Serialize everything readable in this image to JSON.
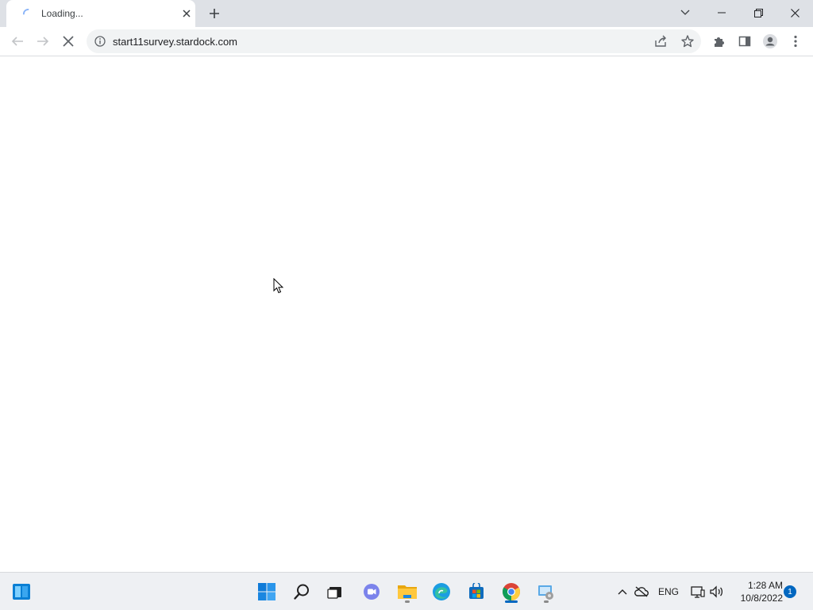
{
  "browser": {
    "tab": {
      "title": "Loading...",
      "close_icon": "close-icon",
      "spinner_icon": "loading-spinner-icon"
    },
    "new_tab_icon": "plus-icon",
    "window_controls": [
      "chevron-down-icon",
      "minimize-icon",
      "restore-icon",
      "close-icon"
    ],
    "toolbar": {
      "back_icon": "back-arrow-icon",
      "forward_icon": "forward-arrow-icon",
      "stop_icon": "stop-icon",
      "site_info_icon": "info-icon",
      "url": "start11survey.stardock.com",
      "share_icon": "share-icon",
      "bookmark_icon": "star-icon",
      "extensions_icon": "puzzle-icon",
      "side_panel_icon": "side-panel-icon",
      "profile_icon": "profile-icon",
      "menu_icon": "kebab-menu-icon"
    }
  },
  "taskbar": {
    "apps": [
      {
        "name": "start",
        "icon": "windows-start-icon"
      },
      {
        "name": "search",
        "icon": "search-icon"
      },
      {
        "name": "task-view",
        "icon": "task-view-icon"
      },
      {
        "name": "chat",
        "icon": "teams-chat-icon"
      },
      {
        "name": "file-explorer",
        "icon": "folder-icon",
        "running": true
      },
      {
        "name": "edge",
        "icon": "edge-icon"
      },
      {
        "name": "store",
        "icon": "store-icon"
      },
      {
        "name": "chrome",
        "icon": "chrome-icon",
        "running": true,
        "active": true
      },
      {
        "name": "control-panel",
        "icon": "settings-app-icon",
        "running": true
      }
    ],
    "tray": {
      "lang": "ENG",
      "time": "1:28 AM",
      "date": "10/8/2022",
      "notifications": "1"
    }
  },
  "colors": {
    "accent": "#0067c0",
    "tabbar": "#dee1e6",
    "omnibox": "#f1f3f4"
  }
}
